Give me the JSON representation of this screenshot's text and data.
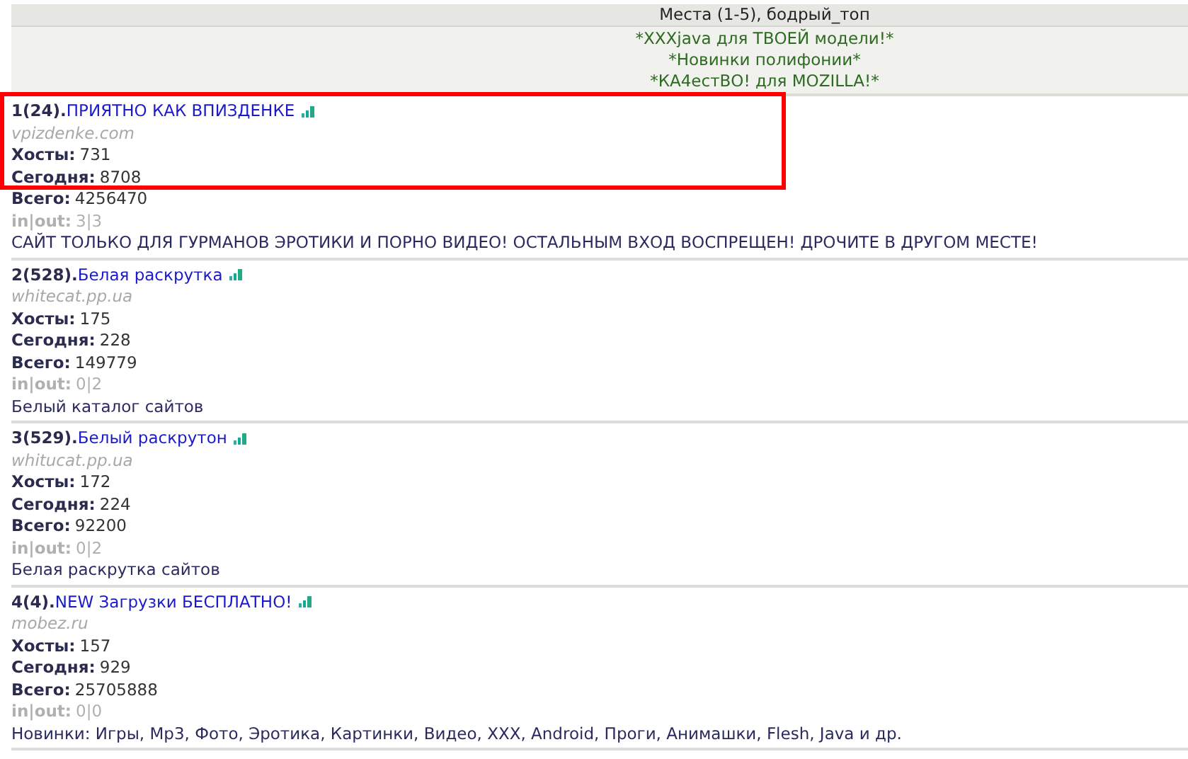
{
  "header": {
    "title": "Места (1-5), бодрый_топ"
  },
  "promos": [
    "*XXXjava для ТВОЕЙ модели!*",
    "*Новинки полифонии*",
    "*КА4естВО! для MOZILLA!*"
  ],
  "entries": [
    {
      "rank": "1(24).",
      "name": "ПРИЯТНО КАК ВПИЗДЕНКЕ",
      "domain": "vpizdenke.com",
      "hosts_label": "Хосты:",
      "hosts": "731",
      "today_label": "Сегодня:",
      "today": "8708",
      "total_label": "Всего:",
      "total": "4256470",
      "inout_label": "in|out:",
      "inout": "3|3",
      "description": "САЙТ ТОЛЬКО ДЛЯ ГУРМАНОВ ЭРОТИКИ И ПОРНО ВИДЕО! ОСТАЛЬНЫМ ВХОД ВОСПРЕЩЕН! ДРОЧИТЕ В ДРУГОМ МЕСТЕ!",
      "highlighted": true
    },
    {
      "rank": "2(528).",
      "name": "Белая раскрутка",
      "domain": "whitecat.pp.ua",
      "hosts_label": "Хосты:",
      "hosts": "175",
      "today_label": "Сегодня:",
      "today": "228",
      "total_label": "Всего:",
      "total": "149779",
      "inout_label": "in|out:",
      "inout": "0|2",
      "description": "Белый каталог сайтов",
      "highlighted": false
    },
    {
      "rank": "3(529).",
      "name": "Белый раскрутон",
      "domain": "whitucat.pp.ua",
      "hosts_label": "Хосты:",
      "hosts": "172",
      "today_label": "Сегодня:",
      "today": "224",
      "total_label": "Всего:",
      "total": "92200",
      "inout_label": "in|out:",
      "inout": "0|2",
      "description": "Белая раскрутка сайтов",
      "highlighted": false
    },
    {
      "rank": "4(4).",
      "name": "NEW Загрузки БЕСПЛАТНО!",
      "domain": "mobez.ru",
      "hosts_label": "Хосты:",
      "hosts": "157",
      "today_label": "Сегодня:",
      "today": "929",
      "total_label": "Всего:",
      "total": "25705888",
      "inout_label": "in|out:",
      "inout": "0|0",
      "description": "Новинки: Игры, Mp3, Фото, Эротика, Картинки, Видео, XXX, Android, Проги, Анимашки, Flesh, Java и др.",
      "highlighted": false
    }
  ]
}
